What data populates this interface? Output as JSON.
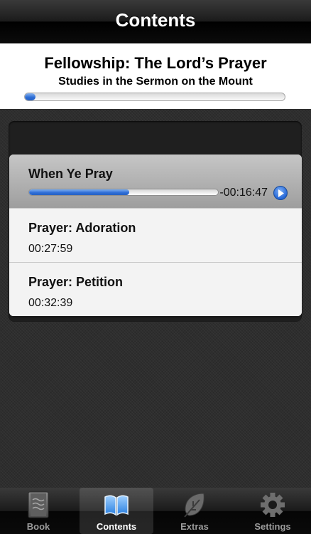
{
  "nav": {
    "title": "Contents"
  },
  "book": {
    "title": "Fellowship: The Lord’s Prayer",
    "subtitle": "Studies in the Sermon on the Mount",
    "overall_progress": 0.04
  },
  "tracks": [
    {
      "title": "When Ye Pray",
      "remaining": "-00:16:47",
      "progress": 0.53,
      "active": true
    },
    {
      "title": "Prayer: Adoration",
      "duration": "00:27:59"
    },
    {
      "title": "Prayer: Petition",
      "duration": "00:32:39"
    }
  ],
  "tabs": [
    {
      "label": "Book",
      "icon": "book-icon"
    },
    {
      "label": "Contents",
      "icon": "open-book-icon",
      "selected": true
    },
    {
      "label": "Extras",
      "icon": "leaf-icon"
    },
    {
      "label": "Settings",
      "icon": "gear-icon"
    }
  ],
  "colors": {
    "accent": "#2e6ed6",
    "navbar": "#1b1b1b",
    "background": "#2e2e2e"
  }
}
